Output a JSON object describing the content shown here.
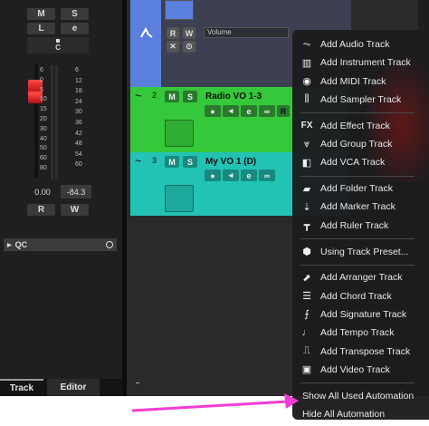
{
  "inspector": {
    "mute": "M",
    "solo": "S",
    "listen": "L",
    "edit": "e",
    "channel": "C",
    "scale_left": [
      "6",
      "0",
      "5",
      "10",
      "15",
      "20",
      "30",
      "40",
      "50",
      "60",
      "80"
    ],
    "scale_right": [
      "6",
      "12",
      "18",
      "24",
      "30",
      "36",
      "42",
      "48",
      "54",
      "60"
    ],
    "volume_value": "0.00",
    "pan_value": "-84.3",
    "read": "R",
    "write": "W",
    "qc_label": "QC",
    "tabs": [
      "Track",
      "Editor"
    ]
  },
  "tracks": [
    {
      "type": "automation",
      "read": "R",
      "write": "W",
      "parameter": "Volume",
      "color": "#5b7fdc"
    },
    {
      "number": "2",
      "mute": "M",
      "solo": "S",
      "name": "Radio VO 1-3",
      "record": "R",
      "color": "#35c83a"
    },
    {
      "number": "3",
      "mute": "M",
      "solo": "S",
      "name": "My VO 1 (D)",
      "color": "#22c3b4"
    }
  ],
  "menu": {
    "groups": [
      [
        {
          "label": "Add Audio Track",
          "icon": "waveform-icon"
        },
        {
          "label": "Add Instrument Track",
          "icon": "keyboard-icon"
        },
        {
          "label": "Add MIDI Track",
          "icon": "midi-icon"
        },
        {
          "label": "Add Sampler Track",
          "icon": "sampler-icon"
        }
      ],
      [
        {
          "label": "Add Effect Track",
          "icon": "fx-icon"
        },
        {
          "label": "Add Group Track",
          "icon": "group-icon"
        },
        {
          "label": "Add VCA Track",
          "icon": "vca-icon"
        }
      ],
      [
        {
          "label": "Add Folder Track",
          "icon": "folder-icon"
        },
        {
          "label": "Add Marker Track",
          "icon": "marker-icon"
        },
        {
          "label": "Add Ruler Track",
          "icon": "ruler-icon"
        }
      ],
      [
        {
          "label": "Using Track Preset...",
          "icon": "preset-icon"
        }
      ],
      [
        {
          "label": "Add Arranger Track",
          "icon": "arranger-icon"
        },
        {
          "label": "Add Chord Track",
          "icon": "chord-icon"
        },
        {
          "label": "Add Signature Track",
          "icon": "signature-icon"
        },
        {
          "label": "Add Tempo Track",
          "icon": "tempo-icon"
        },
        {
          "label": "Add Transpose Track",
          "icon": "transpose-icon"
        },
        {
          "label": "Add Video Track",
          "icon": "video-icon"
        }
      ],
      [
        {
          "label": "Show All Used Automation",
          "icon": ""
        },
        {
          "label": "Hide All Automation",
          "icon": ""
        }
      ]
    ]
  },
  "colors": {
    "arrow": "#f03cd6",
    "fader": "#e02020"
  }
}
